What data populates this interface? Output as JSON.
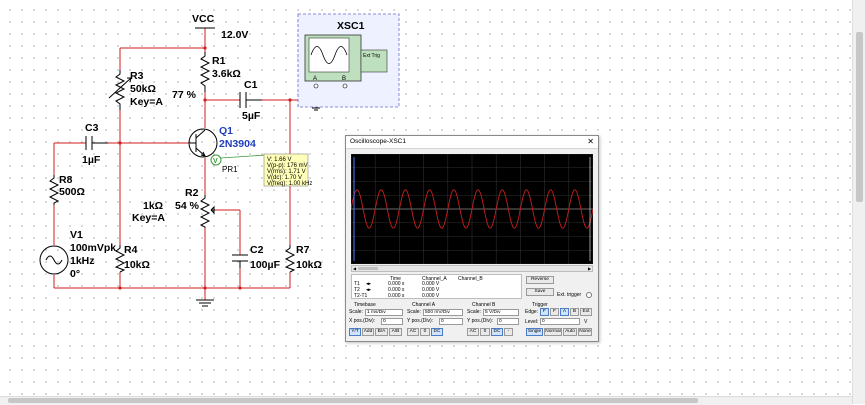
{
  "schematic": {
    "vcc_label": "VCC",
    "vcc_value": "12.0V",
    "r1": {
      "name": "R1",
      "value": "3.6kΩ"
    },
    "r3": {
      "name": "R3",
      "value": "50kΩ",
      "key": "Key=A",
      "percent": "77 %"
    },
    "c1": {
      "name": "C1",
      "value": "5µF"
    },
    "c3": {
      "name": "C3",
      "value": "1µF"
    },
    "q1": {
      "name": "Q1",
      "part": "2N3904"
    },
    "probe": {
      "name": "PR1",
      "symbol": "V",
      "readings": [
        "V: 1.66 V",
        "V(p-p): 176 mV",
        "V(rms): 1.71 V",
        "V(dc): 1.70 V",
        "V(freq): 1.00 kHz"
      ]
    },
    "r8": {
      "name": "R8",
      "value": "500Ω"
    },
    "r2": {
      "name": "R2",
      "value": "1kΩ",
      "key": "Key=A",
      "percent": "54 %"
    },
    "v1": {
      "name": "V1",
      "amp": "100mVpk",
      "freq": "1kHz",
      "phase": "0°"
    },
    "r4": {
      "name": "R4",
      "value": "10kΩ"
    },
    "c2": {
      "name": "C2",
      "value": "100µF"
    },
    "r7": {
      "name": "R7",
      "value": "10kΩ"
    },
    "xsc": {
      "name": "XSC1",
      "ext_trig": "Ext Trig",
      "a": "A",
      "b": "B"
    }
  },
  "oscilloscope": {
    "title": "Oscilloscope-XSC1",
    "close": "✕",
    "colors": {
      "channel_a": "#c81e1e",
      "grid": "#2e2e2e",
      "screen": "#000000"
    },
    "readout": {
      "headers": [
        "Time",
        "Channel_A",
        "Channel_B"
      ],
      "rows": [
        {
          "label": "T1",
          "time": "0.000 s",
          "a": "0.000 V",
          "b": ""
        },
        {
          "label": "T2",
          "time": "0.000 s",
          "a": "0.000 V",
          "b": ""
        },
        {
          "label": "T2-T1",
          "time": "0.000 s",
          "a": "0.000 V",
          "b": ""
        }
      ]
    },
    "reverse": "Reverse",
    "save": "Save",
    "ext_trigger": "Ext. trigger",
    "timebase": {
      "title": "Timebase",
      "scale_label": "Scale:",
      "scale": "1 ms/Div",
      "pos_label": "X pos.(Div):",
      "pos": "0",
      "buttons": [
        "Y/T",
        "Add",
        "B/A",
        "A/B"
      ]
    },
    "channel_a": {
      "title": "Channel A",
      "scale_label": "Scale:",
      "scale": "500 mV/Div",
      "pos_label": "Y pos.(Div):",
      "pos": "0",
      "buttons": [
        "AC",
        "0",
        "DC"
      ]
    },
    "channel_b": {
      "title": "Channel B",
      "scale_label": "Scale:",
      "scale": "5 V/Div",
      "pos_label": "Y pos.(Div):",
      "pos": "0",
      "buttons": [
        "AC",
        "0",
        "DC",
        "-"
      ]
    },
    "trigger": {
      "title": "Trigger",
      "edge_label": "Edge:",
      "edge_buttons": [
        "F",
        "F",
        "A",
        "B",
        "Ext"
      ],
      "level_label": "Level:",
      "level": "0",
      "level_unit": "V",
      "mode_buttons": [
        "Single",
        "Normal",
        "Auto",
        "None"
      ]
    },
    "waveform": {
      "cycles": 10,
      "amplitude_div": 0.35,
      "offset_div": 0
    }
  }
}
